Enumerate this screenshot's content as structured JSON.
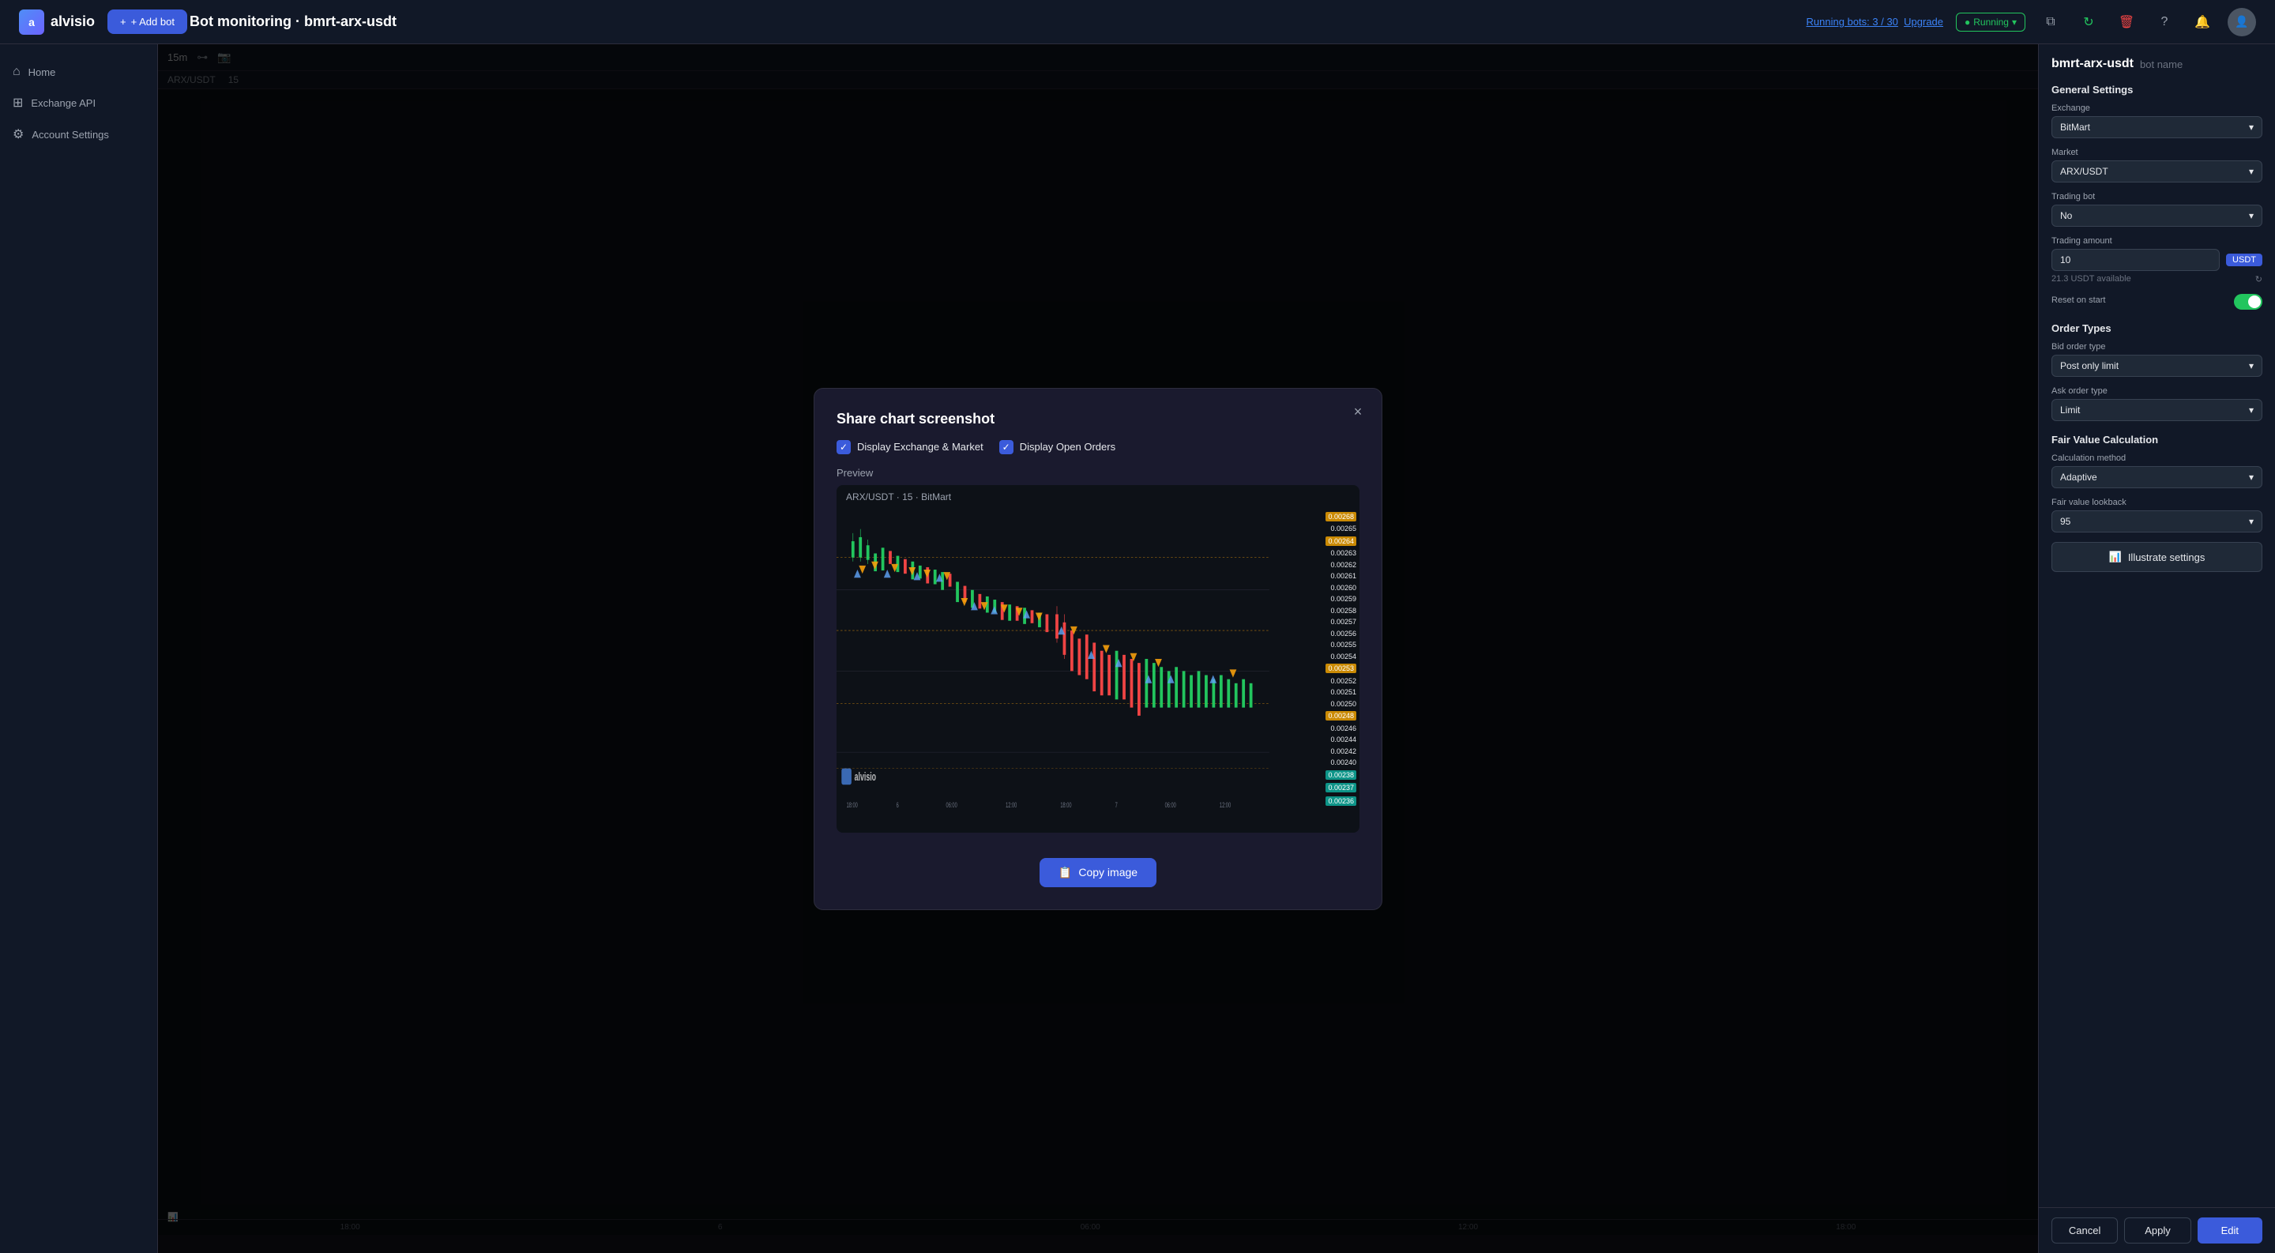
{
  "topbar": {
    "logo_text": "alvisio",
    "add_bot_label": "+ Add bot",
    "page_title": "Bot monitoring · bmrt-arx-usdt",
    "running_info": "Running bots: 3 / 30",
    "upgrade_label": "Upgrade",
    "running_badge": "Running",
    "topbar_icons": [
      "?",
      "🔔"
    ]
  },
  "sidebar": {
    "items": [
      {
        "label": "Home",
        "icon": "⌂"
      },
      {
        "label": "Exchange API",
        "icon": "⊞"
      },
      {
        "label": "Account Settings",
        "icon": "⚙"
      }
    ]
  },
  "modal": {
    "title": "Share chart screenshot",
    "close_label": "×",
    "checkbox1_label": "Display Exchange & Market",
    "checkbox2_label": "Display Open Orders",
    "preview_label": "Preview",
    "chart_header": "ARX/USDT · 15 · BitMart",
    "copy_button": "Copy image",
    "xaxis_labels": [
      "18:00",
      "6",
      "06:00",
      "12:00",
      "18:00",
      "7",
      "06:00",
      "12:00"
    ],
    "yaxis_prices": [
      "0.00268",
      "0.00251",
      "0.00265",
      "0.00264",
      "0.00263",
      "0.00262",
      "0.00261",
      "0.00260",
      "0.00259",
      "0.00258",
      "0.00257",
      "0.00256",
      "0.00255",
      "0.00254",
      "0.00253",
      "0.00252",
      "0.00251",
      "0.00250",
      "0.00248",
      "0.00246",
      "0.00244",
      "0.00242",
      "0.00240",
      "0.00238",
      "0.00237",
      "0.00236"
    ],
    "highlight_prices": [
      "0.00268",
      "0.00248",
      "0.00238",
      "0.00237",
      "0.00236"
    ]
  },
  "right_panel": {
    "bot_name": "bmrt-arx-usdt",
    "bot_name_suffix": "bot name",
    "sections": {
      "general": {
        "title": "General Settings",
        "exchange_label": "Exchange",
        "exchange_value": "BitMart",
        "market_label": "Market",
        "market_value": "ARX/USDT",
        "trading_bot_label": "Trading bot",
        "trading_bot_value": "No",
        "trading_amount_label": "Trading amount",
        "trading_amount_value": "10",
        "trading_amount_badge": "USDT",
        "available_text": "21.3 USDT available",
        "reset_on_start_label": "Reset on start"
      },
      "order_types": {
        "title": "Order Types",
        "bid_label": "Bid order type",
        "bid_value": "Post only limit",
        "ask_label": "Ask order type",
        "ask_value": "Limit"
      },
      "fair_value": {
        "title": "Fair Value Calculation",
        "method_label": "Calculation method",
        "method_value": "Adaptive",
        "lookback_label": "Fair value lookback"
      }
    },
    "buttons": {
      "illustrate": "Illustrate settings",
      "cancel": "Cancel",
      "apply": "Apply",
      "edit": "Edit"
    }
  }
}
